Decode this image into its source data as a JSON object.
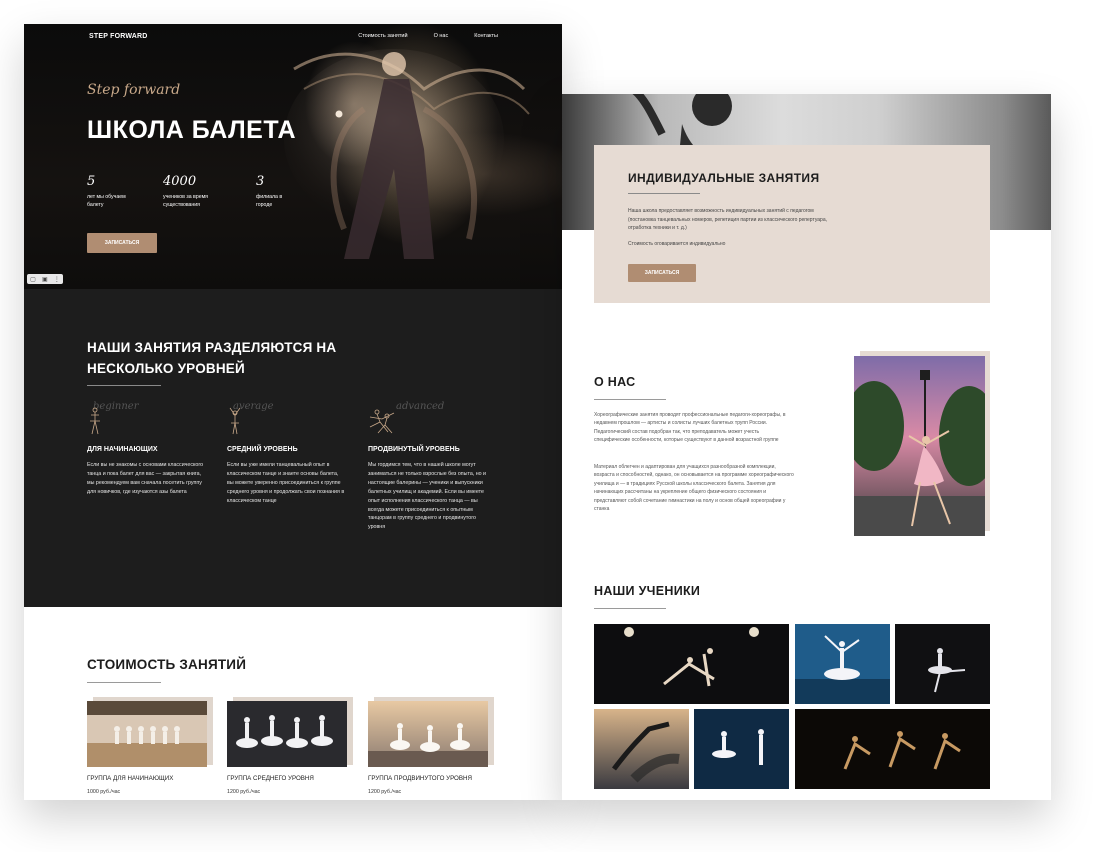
{
  "left_page": {
    "nav": {
      "logo": "STEP FORWARD",
      "links": [
        "Стоимость занятий",
        "О нас",
        "Контакты"
      ]
    },
    "hero": {
      "script": "Step forward",
      "title": "ШКОЛА БАЛЕТА",
      "stats": [
        {
          "number": "5",
          "caption": "лет мы обучаем балету"
        },
        {
          "number": "4000",
          "caption": "учеников за время существования"
        },
        {
          "number": "3",
          "caption": "филиала в городе"
        }
      ],
      "cta": "ЗАПИСАТЬСЯ"
    },
    "levels": {
      "title": "НАШИ ЗАНЯТИЯ РАЗДЕЛЯЮТСЯ НА НЕСКОЛЬКО УРОВНЕЙ",
      "items": [
        {
          "bg_word": "beginner",
          "title": "ДЛЯ НАЧИНАЮЩИХ",
          "text": "Если вы не знакомы с основами классического танца и пока балет для вас — закрытая книга, мы рекомендуем вам сначала посетить группу для новичков, где изучаются азы балета",
          "icon": "ballerina-beginner-icon"
        },
        {
          "bg_word": "average",
          "title": "СРЕДНИЙ УРОВЕНЬ",
          "text": "Если вы уже имели танцевальный опыт в классическом танце и знаете основы балета, вы можете уверенно присоединиться к группе среднего уровня и продолжать свои познания в классическом танце",
          "icon": "ballerina-average-icon"
        },
        {
          "bg_word": "advanced",
          "title": "ПРОДВИНУТЫЙ УРОВЕНЬ",
          "text": "Мы гордимся тем, что в нашей школе могут заниматься не только взрослые без опыта, но и настоящие балерины — ученики и выпускники балетных училищ и академий. Если вы имеете опыт исполнения классического танца — вы всегда можете присоединиться к опытным танцорам в группу среднего и продвинутого уровня",
          "icon": "ballet-pair-icon"
        }
      ]
    },
    "pricing": {
      "title": "СТОИМОСТЬ ЗАНЯТИЙ",
      "cards": [
        {
          "group": "ГРУППА ДЛЯ НАЧИНАЮЩИХ",
          "price": "1000 руб./час"
        },
        {
          "group": "ГРУППА СРЕДНЕГО УРОВНЯ",
          "price": "1200 руб./час"
        },
        {
          "group": "ГРУППА ПРОДВИНУТОГО УРОВНЯ",
          "price": "1200 руб./час"
        }
      ]
    }
  },
  "right_page": {
    "individual": {
      "title": "ИНДИВИДУАЛЬНЫЕ ЗАНЯТИЯ",
      "text": "Наша школа предоставляет возможность индивидуальных занятий с педагогом (постановка танцевальных номеров, репетиция партии из классического репертуара, отработка техники и т. д.)",
      "note": "Стоимость оговаривается индивидуально",
      "cta": "ЗАПИСАТЬСЯ"
    },
    "about": {
      "title": "О НАС",
      "p1": "Хореографические занятия проводят профессиональные педагоги-хореографы, в недавнем прошлом — артисты и солисты лучших балетных трупп России. Педагогический состав подобран так, что преподаватель может учесть специфические особенности, которые существуют в данной возрастной группе",
      "p2": "Материал облегчен и адаптирован для учащихся разнообразной комплекции, возраста и способностей, однако, он основывается на программе хореографического училища и — в традициях Русской школы классического балета. Занятия для начинающих рассчитаны на укрепление общего физического состояния и представляют собой сочетание гимнастики на полу и основ общей хореографии у станка"
    },
    "students": {
      "title": "НАШИ УЧЕНИКИ"
    }
  },
  "colors": {
    "accent": "#b08d72",
    "dark_section": "#1d1d1d",
    "card_beige": "#e6dbd3",
    "script_gold": "#c9a98a"
  }
}
